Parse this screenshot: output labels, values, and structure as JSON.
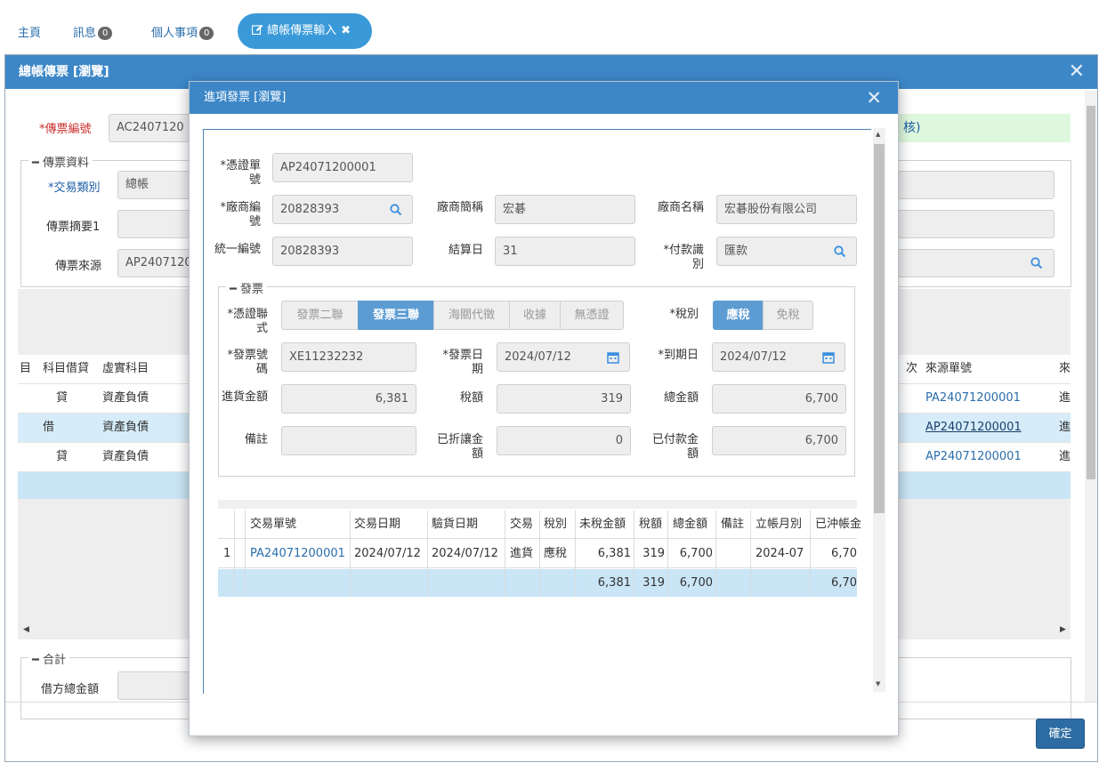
{
  "nav": {
    "home": "主頁",
    "messages": "訊息",
    "messages_count": "0",
    "personal": "個人事項",
    "personal_count": "0",
    "active_tab": "總帳傳票輸入"
  },
  "main": {
    "title": "總帳傳票 [瀏覽]",
    "voucher_no_label": "*傳票編號",
    "voucher_no": "AC2407120",
    "note_tail": "核)",
    "group_voucher": "傳票資料",
    "trade_type_label": "*交易類別",
    "trade_type": "總帳",
    "summary_label": "傳票摘要1",
    "summary": "",
    "source_label": "傳票來源",
    "source": "AP2407120",
    "table": {
      "headers": [
        "目",
        "科目借貸",
        "虛實科目",
        "次",
        "來源單號",
        "來"
      ],
      "rows": [
        {
          "dc": "貸",
          "kind": "資產負債",
          "source_no": "PA24071200001",
          "trail": "進"
        },
        {
          "dc": "借",
          "kind": "資產負債",
          "source_no": "AP24071200001",
          "trail": "進"
        },
        {
          "dc": "貸",
          "kind": "資產負債",
          "source_no": "AP24071200001",
          "trail": "進"
        }
      ]
    },
    "group_total": "合計",
    "debit_total_label": "借方總金額",
    "ok_button": "確定"
  },
  "modal": {
    "title": "進項發票 [瀏覽]",
    "fields": {
      "voucher_doc_label": "*憑證單號",
      "voucher_doc": "AP24071200001",
      "vendor_no_label": "*廠商編號",
      "vendor_no": "20828393",
      "vendor_short_label": "廠商簡稱",
      "vendor_short": "宏碁",
      "vendor_name_label": "廠商名稱",
      "vendor_name": "宏碁股份有限公司",
      "unified_no_label": "統一編號",
      "unified_no": "20828393",
      "settle_day_label": "結算日",
      "settle_day": "31",
      "pay_method_label": "*付款識別",
      "pay_method": "匯款"
    },
    "invoice": {
      "group": "發票",
      "copy_label": "*憑證聯式",
      "copy_options": [
        "發票二聯",
        "發票三聯",
        "海關代徵",
        "收據",
        "無憑證"
      ],
      "copy_selected": "發票三聯",
      "tax_label": "*稅別",
      "tax_options": [
        "應稅",
        "免稅"
      ],
      "tax_selected": "應稅",
      "invoice_no_label": "*發票號碼",
      "invoice_no": "XE11232232",
      "invoice_date_label": "*發票日期",
      "invoice_date": "2024/07/12",
      "due_date_label": "*到期日",
      "due_date": "2024/07/12",
      "purchase_amt_label": "進貨金額",
      "purchase_amt": "6,381",
      "tax_amt_label": "稅額",
      "tax_amt": "319",
      "total_amt_label": "總金額",
      "total_amt": "6,700",
      "remark_label": "備註",
      "remark": "",
      "discount_label": "已折讓金額",
      "discount": "0",
      "paid_label": "已付款金額",
      "paid": "6,700"
    },
    "table": {
      "headers": [
        "交易單號",
        "交易日期",
        "驗貨日期",
        "交易",
        "稅別",
        "未稅金額",
        "稅額",
        "總金額",
        "備註",
        "立帳月別",
        "已沖帳金"
      ],
      "rows": [
        {
          "idx": "1",
          "doc_no": "PA24071200001",
          "trade_date": "2024/07/12",
          "inspect_date": "2024/07/12",
          "trade": "進貨",
          "tax": "應稅",
          "net": "6,381",
          "tax_amt": "319",
          "total": "6,700",
          "remark": "",
          "month": "2024-07",
          "offset": "6,70"
        }
      ],
      "summary": {
        "net": "6,381",
        "tax_amt": "319",
        "total": "6,700",
        "offset": "6,70"
      }
    }
  }
}
